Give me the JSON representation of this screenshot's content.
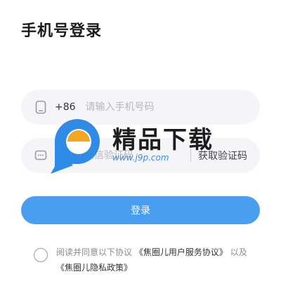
{
  "page": {
    "title": "手机号登录"
  },
  "phone": {
    "icon": "phone-icon",
    "country_code": "+86",
    "placeholder": "请输入手机号码"
  },
  "code": {
    "icon": "message-icon",
    "placeholder": "请输入短信验证码",
    "get_code_label": "获取验证码"
  },
  "login": {
    "label": "登录"
  },
  "agreement": {
    "prefix": "阅读并同意以下协议",
    "service_link": "《焦圈儿用户服务协议》",
    "middle": "以及",
    "privacy_link": "《焦圈儿隐私政策》"
  },
  "watermark": {
    "title": "精品下载",
    "url": "www.j9p.com"
  },
  "colors": {
    "accent": "#4a9ef0",
    "field_bg": "#f5f5f7",
    "watermark_blue": "#3a8fe0"
  }
}
